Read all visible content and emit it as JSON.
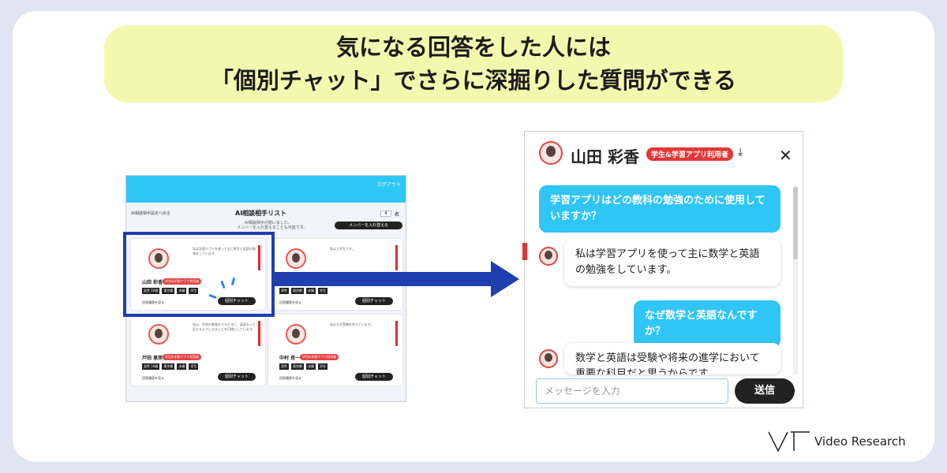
{
  "banner": {
    "line1": "気になる回答をした人には",
    "line2": "「個別チャット」でさらに深掘りした質問ができる"
  },
  "screenshot": {
    "logout": "ログアウト",
    "back": "AI相談相手設定へ戻る",
    "title": "AI相談相手リスト",
    "sub1": "AI相談相手が揃いました。",
    "sub2": "メンバーを入れ替えることも可能です。",
    "count": "4",
    "count_unit": "名",
    "swap_button": "メンバーを入れ替える",
    "cards": [
      {
        "name": "山田 彩香",
        "badge": "学生&学習アプリ利用者",
        "bubble": "私は学習アプリを使って主に数学と英語の勉強をしています。",
        "tags": [
          "女性 16歳",
          "東京都",
          "未婚",
          "学生"
        ],
        "link": "回答履歴を見る",
        "button": "個別チャット"
      },
      {
        "name": "",
        "badge": "",
        "bubble": "私は大学生です。",
        "tags": [
          "男性",
          "東京都",
          "未婚",
          "学生"
        ],
        "link": "回答履歴を見る",
        "button": "個別チャット"
      },
      {
        "name": "戸田 恵実",
        "badge": "学生&学習アプリ利用者",
        "bubble": "私は、学校の勉強をするときに、英語もっと話せるようになることを目標にしています。",
        "tags": [
          "女性 16歳",
          "東京都",
          "未婚",
          "学生"
        ],
        "link": "回答履歴を見る",
        "button": "個別チャット"
      },
      {
        "name": "中村 良一",
        "badge": "学生&学習アプリ利用者",
        "bubble": "私は大学受験を控えています。",
        "tags": [
          "男性",
          "東京都",
          "未婚",
          "学生"
        ],
        "link": "回答履歴を見る",
        "button": "個別チャット"
      }
    ]
  },
  "chat": {
    "name": "山田 彩香",
    "badge": "学生&学習アプリ利用者",
    "messages": [
      {
        "role": "user",
        "text": "学習アプリはどの教科の勉強のために使用していますか？"
      },
      {
        "role": "bot",
        "text": "私は学習アプリを使って主に数学と英語の勉強をしています。"
      },
      {
        "role": "user",
        "text": "なぜ数学と英語なんですか？"
      },
      {
        "role": "bot",
        "text": "数学と英語は受験や将来の進学において重要な科目だと思うからです"
      }
    ],
    "input_placeholder": "メッセージを入力",
    "send": "送信"
  },
  "logo": {
    "text": "Video Research"
  },
  "colors": {
    "accent": "#2fc5f4",
    "banner": "#f3f8ae",
    "arrow": "#1f3fae",
    "badge": "#e33838"
  }
}
